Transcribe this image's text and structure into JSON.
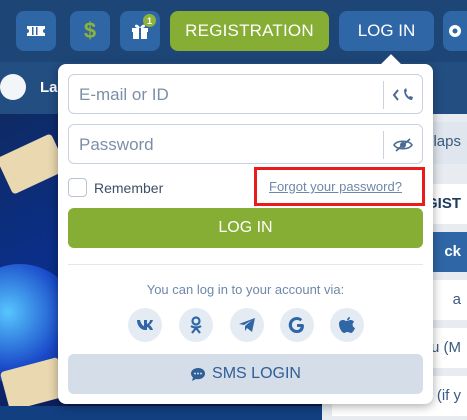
{
  "header": {
    "ticket_icon": "ticket-icon",
    "dollar_symbol": "$",
    "gift_badge_count": "1",
    "registration_label": "REGISTRATION",
    "login_label": "LOG IN",
    "gear_icon": "gear-icon"
  },
  "subnav": {
    "label": "La"
  },
  "right_panel": {
    "items": [
      "ollaps",
      "GIST",
      "ck",
      "a",
      "eu (M",
      "ne (if y"
    ]
  },
  "login_popover": {
    "email_placeholder": "E-mail or ID",
    "password_placeholder": "Password",
    "remember_label": "Remember",
    "forgot_link": "Forgot your password?",
    "login_button": "LOG IN",
    "via_text": "You can log in to your account via:",
    "social": [
      {
        "name": "vk",
        "glyph": "vk"
      },
      {
        "name": "odnoklassniki",
        "glyph": "ok"
      },
      {
        "name": "telegram",
        "glyph": "tg"
      },
      {
        "name": "google",
        "glyph": "G"
      },
      {
        "name": "apple",
        "glyph": "apple"
      }
    ],
    "sms_button": "SMS LOGIN"
  },
  "colors": {
    "header_bg": "#1d4677",
    "accent_blue": "#2f66a6",
    "accent_green": "#86ad34",
    "highlight_red": "#ea1b1b"
  }
}
